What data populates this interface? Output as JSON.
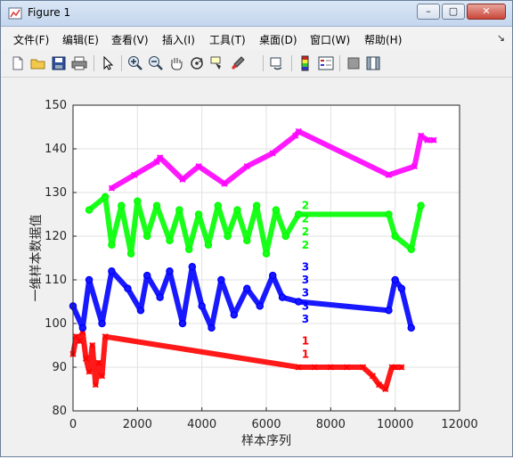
{
  "window": {
    "title": "Figure 1",
    "minimize_symbol": "–",
    "maximize_symbol": "▢",
    "close_symbol": "✕"
  },
  "menu": {
    "items": [
      {
        "label": "文件(F)"
      },
      {
        "label": "编辑(E)"
      },
      {
        "label": "查看(V)"
      },
      {
        "label": "插入(I)"
      },
      {
        "label": "工具(T)"
      },
      {
        "label": "桌面(D)"
      },
      {
        "label": "窗口(W)"
      },
      {
        "label": "帮助(H)"
      }
    ],
    "dock_symbol": "↘"
  },
  "toolbar": {
    "buttons": [
      {
        "icon": "new-figure-icon"
      },
      {
        "icon": "open-file-icon"
      },
      {
        "icon": "save-icon"
      },
      {
        "icon": "print-icon"
      },
      {
        "icon": "edit-plot-arrow-icon"
      },
      {
        "icon": "zoom-in-icon"
      },
      {
        "icon": "zoom-out-icon"
      },
      {
        "icon": "pan-hand-icon"
      },
      {
        "icon": "rotate-3d-icon"
      },
      {
        "icon": "data-cursor-icon"
      },
      {
        "icon": "brush-icon"
      },
      {
        "icon": "link-plot-icon"
      },
      {
        "icon": "colorbar-icon"
      },
      {
        "icon": "legend-icon"
      },
      {
        "icon": "hide-plot-tools-icon"
      },
      {
        "icon": "show-plot-tools-icon"
      }
    ]
  },
  "chart_data": {
    "type": "scatter",
    "title": "",
    "xlabel": "样本序列",
    "ylabel": "一维样本数据值",
    "xlim": [
      0,
      12000
    ],
    "ylim": [
      80,
      150
    ],
    "xticks": [
      "0",
      "2000",
      "4000",
      "6000",
      "8000",
      "10000",
      "12000"
    ],
    "yticks": [
      "80",
      "90",
      "100",
      "110",
      "120",
      "130",
      "140",
      "150"
    ],
    "grid": true,
    "colors": {
      "1": "#ff0000",
      "2": "#00ff00",
      "3": "#0000ff",
      "4": "#ff00ff"
    },
    "series": [
      {
        "level": 1,
        "color": "#ff0000",
        "marker": "x",
        "x": [
          0,
          100,
          200,
          300,
          400,
          500,
          600,
          700,
          800,
          900,
          1000,
          7000,
          7500,
          8000,
          8500,
          9000,
          9300,
          9500,
          9700,
          9900,
          10000,
          10200
        ],
        "y": [
          93,
          97,
          96,
          98,
          92,
          89,
          95,
          86,
          91,
          88,
          97,
          90,
          90,
          90,
          90,
          90,
          88,
          86,
          85,
          90,
          90,
          90
        ]
      },
      {
        "level": 2,
        "color": "#00ff00",
        "marker": "o",
        "x": [
          500,
          1000,
          1200,
          1500,
          1800,
          2000,
          2300,
          2600,
          3000,
          3300,
          3600,
          3900,
          4200,
          4500,
          4800,
          5100,
          5400,
          5700,
          6000,
          6300,
          6600,
          7000,
          9800,
          10000,
          10500,
          10800
        ],
        "y": [
          126,
          129,
          118,
          127,
          116,
          128,
          120,
          127,
          119,
          126,
          117,
          125,
          118,
          127,
          120,
          126,
          119,
          127,
          116,
          126,
          120,
          125,
          125,
          120,
          117,
          127
        ]
      },
      {
        "level": 3,
        "color": "#0000ff",
        "marker": "o",
        "x": [
          0,
          300,
          500,
          900,
          1200,
          1700,
          2100,
          2300,
          2700,
          3000,
          3400,
          3700,
          4000,
          4300,
          4600,
          5000,
          5400,
          5800,
          6200,
          6500,
          7000,
          9800,
          10000,
          10200,
          10500
        ],
        "y": [
          104,
          99,
          110,
          100,
          112,
          108,
          103,
          111,
          106,
          112,
          100,
          113,
          104,
          99,
          110,
          102,
          108,
          104,
          111,
          106,
          105,
          103,
          110,
          108,
          99
        ]
      },
      {
        "level": 4,
        "color": "#ff00ff",
        "marker": "x",
        "x": [
          1200,
          1900,
          2600,
          2700,
          3400,
          3900,
          4700,
          5400,
          6200,
          6900,
          7000,
          9800,
          10600,
          10800,
          11000,
          11200
        ],
        "y": [
          131,
          134,
          137,
          138,
          133,
          136,
          132,
          136,
          139,
          143,
          144,
          134,
          136,
          143,
          142,
          142
        ]
      }
    ],
    "annotations": {
      "left": [
        {
          "text": "2",
          "color": "#00ff00"
        },
        {
          "text": "2",
          "color": "#00ff00"
        },
        {
          "text": "2",
          "color": "#00ff00"
        },
        {
          "text": "2",
          "color": "#00ff00"
        },
        {
          "text": "3",
          "color": "#0000ff"
        },
        {
          "text": "3",
          "color": "#0000ff"
        },
        {
          "text": "3",
          "color": "#0000ff"
        },
        {
          "text": "3",
          "color": "#0000ff"
        },
        {
          "text": "3",
          "color": "#0000ff"
        },
        {
          "text": "1",
          "color": "#ff0000"
        },
        {
          "text": "1",
          "color": "#ff0000"
        }
      ]
    }
  }
}
